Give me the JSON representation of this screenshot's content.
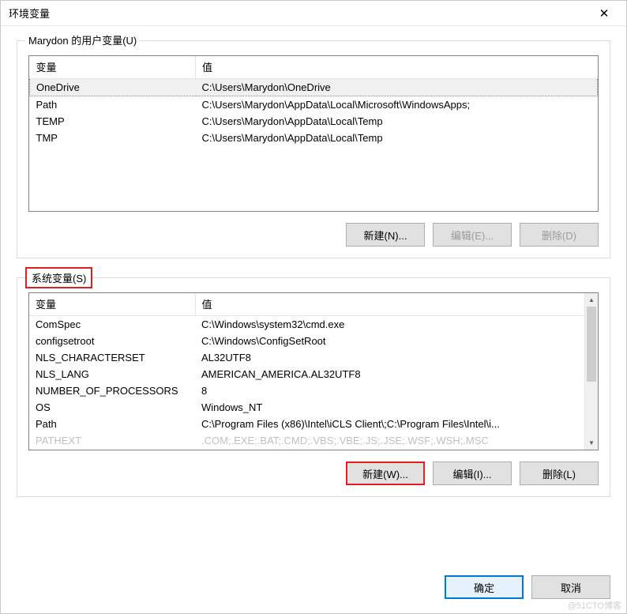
{
  "titlebar": {
    "title": "环境变量",
    "close_icon": "✕"
  },
  "user_vars": {
    "label": "Marydon 的用户变量(U)",
    "header_var": "变量",
    "header_val": "值",
    "rows": [
      {
        "var": "OneDrive",
        "val": "C:\\Users\\Marydon\\OneDrive"
      },
      {
        "var": "Path",
        "val": "C:\\Users\\Marydon\\AppData\\Local\\Microsoft\\WindowsApps;"
      },
      {
        "var": "TEMP",
        "val": "C:\\Users\\Marydon\\AppData\\Local\\Temp"
      },
      {
        "var": "TMP",
        "val": "C:\\Users\\Marydon\\AppData\\Local\\Temp"
      }
    ],
    "btn_new": "新建(N)...",
    "btn_edit": "编辑(E)...",
    "btn_delete": "删除(D)"
  },
  "sys_vars": {
    "label": "系统变量(S)",
    "header_var": "变量",
    "header_val": "值",
    "rows": [
      {
        "var": "ComSpec",
        "val": "C:\\Windows\\system32\\cmd.exe"
      },
      {
        "var": "configsetroot",
        "val": "C:\\Windows\\ConfigSetRoot"
      },
      {
        "var": "NLS_CHARACTERSET",
        "val": "AL32UTF8"
      },
      {
        "var": "NLS_LANG",
        "val": "AMERICAN_AMERICA.AL32UTF8"
      },
      {
        "var": "NUMBER_OF_PROCESSORS",
        "val": "8"
      },
      {
        "var": "OS",
        "val": "Windows_NT"
      },
      {
        "var": "Path",
        "val": "C:\\Program Files (x86)\\Intel\\iCLS Client\\;C:\\Program Files\\Intel\\i..."
      },
      {
        "var": "PATHEXT",
        "val": ".COM;.EXE;.BAT;.CMD;.VBS;.VBE;.JS;.JSE;.WSF;.WSH;.MSC"
      }
    ],
    "btn_new": "新建(W)...",
    "btn_edit": "编辑(I)...",
    "btn_delete": "删除(L)"
  },
  "dialog": {
    "ok": "确定",
    "cancel": "取消"
  },
  "watermark": "@51CTO博客"
}
